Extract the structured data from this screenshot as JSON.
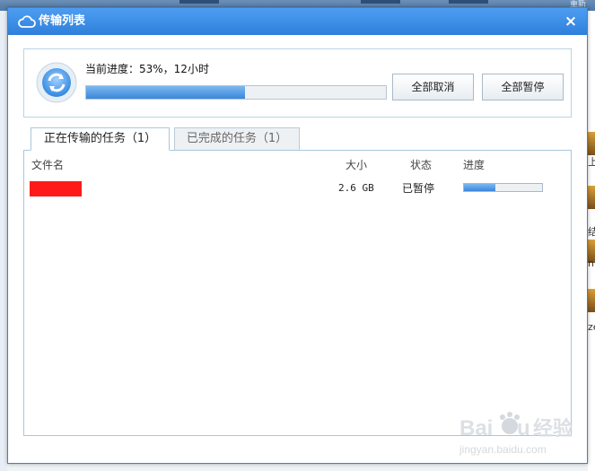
{
  "background": {
    "top_right_text": "重新",
    "right_edge_texts": [
      "上",
      "结",
      "ni",
      "ze"
    ]
  },
  "dialog": {
    "title": "传输列表",
    "close_glyph": "×",
    "title_icon": "cloud-icon"
  },
  "progress": {
    "label": "当前进度：53%，12小时",
    "percent": 53,
    "icon": "sync-icon",
    "cancel_all_label": "全部取消",
    "pause_all_label": "全部暂停"
  },
  "tabs": [
    {
      "label": "正在传输的任务（1）",
      "active": true
    },
    {
      "label": "已完成的任务（1）",
      "active": false
    }
  ],
  "table": {
    "columns": [
      "文件名",
      "大小",
      "状态",
      "进度"
    ],
    "rows": [
      {
        "name": "",
        "size": "2.6 GB",
        "status": "已暂停",
        "progress": 0.4
      }
    ]
  },
  "watermark": {
    "brand": "Baidu",
    "brand_cn": "经验",
    "url": "jingyan.baidu.com"
  },
  "colors": {
    "title_bar": "#2f7fdb",
    "progress_fill": "#3b86db",
    "redaction": "#ff1a1a"
  }
}
